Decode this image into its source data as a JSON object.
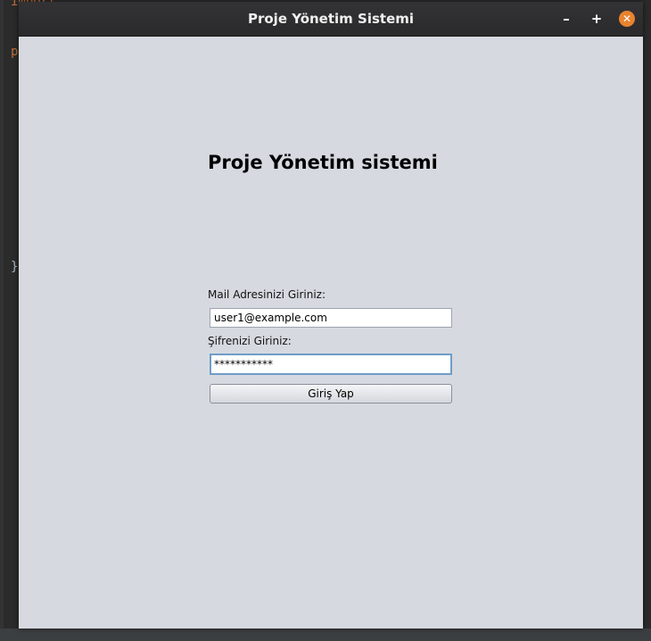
{
  "background_code": {
    "line1": "import",
    "line2": "p",
    "line3": "}"
  },
  "window": {
    "title": "Proje Yönetim Sistemi",
    "buttons": {
      "minimize": "–",
      "maximize": "+",
      "close": "✕"
    }
  },
  "form": {
    "heading": "Proje Yönetim sistemi",
    "email_label": "Mail Adresinizi Giriniz:",
    "email_value": "user1@example.com",
    "password_label": "Şifrenizi Giriniz:",
    "password_value": "***********",
    "login_button": "Giriş Yap"
  },
  "colors": {
    "titlebar": "#2d2d2f",
    "window_bg": "#d6d9e0",
    "close_button": "#e9832f",
    "focus_border": "#6f9dc9"
  }
}
